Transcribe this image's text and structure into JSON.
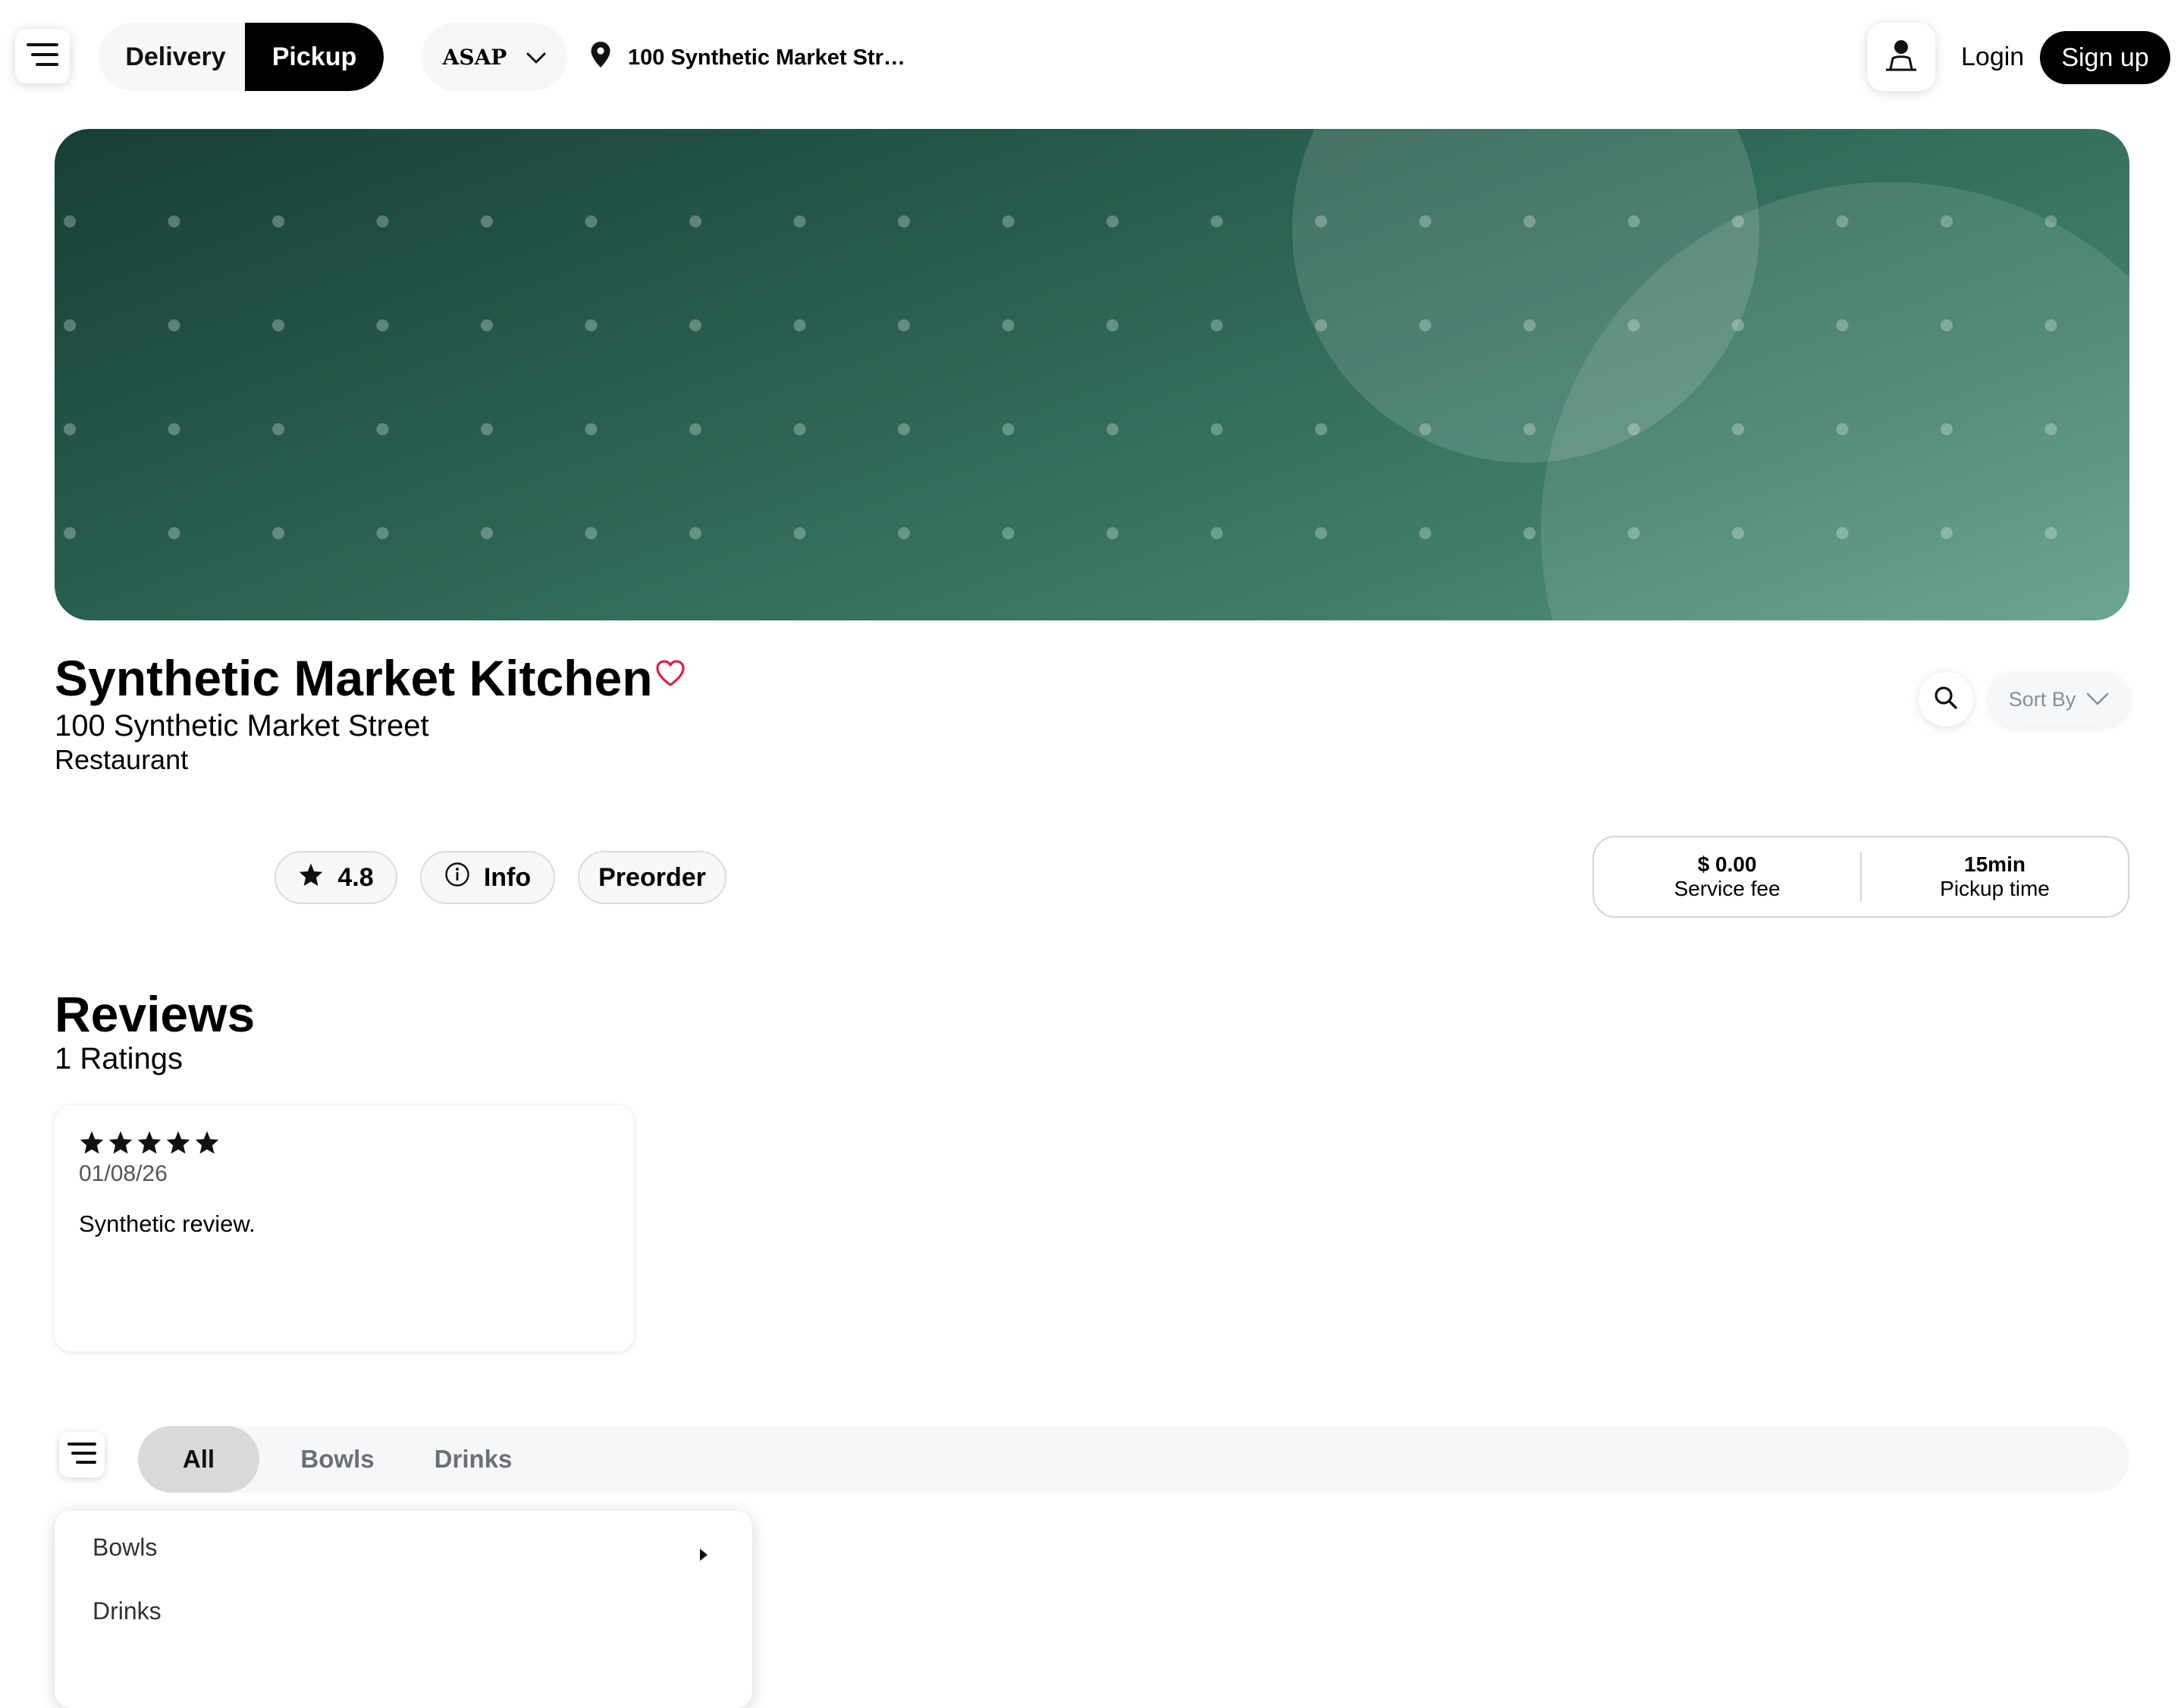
{
  "header": {
    "mode_options": [
      "Delivery",
      "Pickup"
    ],
    "active_mode": "Pickup",
    "time_select": "ASAP",
    "address": "100 Synthetic Market Str…",
    "login": "Login",
    "signup": "Sign up"
  },
  "store": {
    "name": "Synthetic Market Kitchen",
    "address": "100 Synthetic Market Street",
    "type": "Restaurant",
    "rating": "4.8",
    "info_label": "Info",
    "preorder_label": "Preorder",
    "sort_label": "Sort By",
    "fees": [
      {
        "value": "$ 0.00",
        "label": "Service fee"
      },
      {
        "value": "15min",
        "label": "Pickup time"
      }
    ]
  },
  "reviews": {
    "title": "Reviews",
    "count_label": "1 Ratings",
    "items": [
      {
        "stars": 5,
        "date": "01/08/26",
        "text": "Synthetic review."
      }
    ]
  },
  "categories": {
    "tabs": [
      "All",
      "Bowls",
      "Drinks"
    ],
    "active": "All",
    "dropdown": [
      "Bowls",
      "Drinks"
    ]
  },
  "colors": {
    "banner_dark": "#173f35",
    "banner_light": "#5a9a85",
    "heart": "#e0204a",
    "primary": "#000000"
  },
  "icons": [
    "menu-icon",
    "chevron-down-icon",
    "location-pin-icon",
    "user-icon",
    "heart-icon",
    "search-icon",
    "star-icon",
    "info-icon",
    "caret-right-icon"
  ]
}
